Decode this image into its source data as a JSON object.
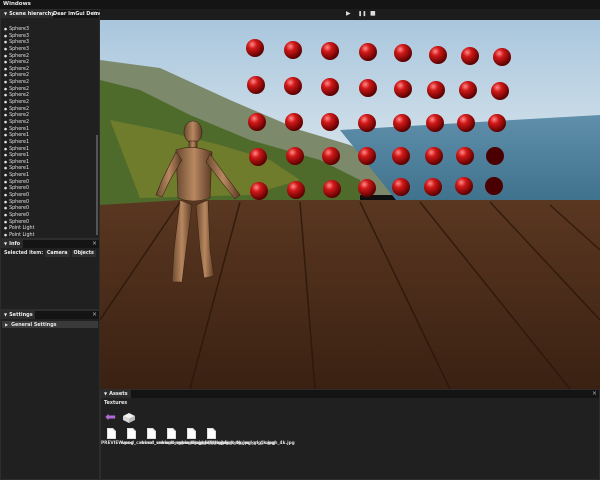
{
  "menubar": {
    "title": "Windows"
  },
  "hierarchy": {
    "tabs": [
      "Scene hierarchy",
      "Dear ImGui Demo"
    ],
    "items": [
      "Sphere3",
      "Sphere3",
      "Sphere3",
      "Sphere3",
      "Sphere2",
      "Sphere2",
      "Sphere2",
      "Sphere2",
      "Sphere2",
      "Sphere2",
      "Sphere2",
      "Sphere2",
      "Sphere2",
      "Sphere2",
      "Sphere2",
      "Sphere1",
      "Sphere1",
      "Sphere1",
      "Sphere1",
      "Sphere1",
      "Sphere1",
      "Sphere1",
      "Sphere1",
      "Sphere0",
      "Sphere0",
      "Sphere0",
      "Sphere0",
      "Sphere0",
      "Sphere0",
      "Sphere0",
      "Point Light",
      "Point Light",
      "Point Light",
      "Directional Light"
    ]
  },
  "info": {
    "tab": "Info",
    "selected_label": "Selected item:",
    "buttons": [
      "Camera",
      "Objects"
    ]
  },
  "settings": {
    "tab": "Settings",
    "section": "General Settings"
  },
  "toolbar": {
    "play": "▶",
    "pause": "❚❚",
    "stop": "■"
  },
  "assets": {
    "tab": "Assets",
    "section": "Textures",
    "files": [
      "PREVIEW.png",
      "wood_cabinet_worn_long_ao_4k.jpg",
      "wood_cabinet_worn_long_diff_4k.jpg",
      "wood_cabinet_worn_long_disp_4k.jpg",
      "wood_cabinet_worn_long_nor_gl_4k.jpg",
      "wood_cabinet_worn_long_rough_4k.jpg"
    ]
  },
  "colors": {
    "accent": "#3a3a3a",
    "sphere": "#d01010",
    "bg": "#202020"
  }
}
